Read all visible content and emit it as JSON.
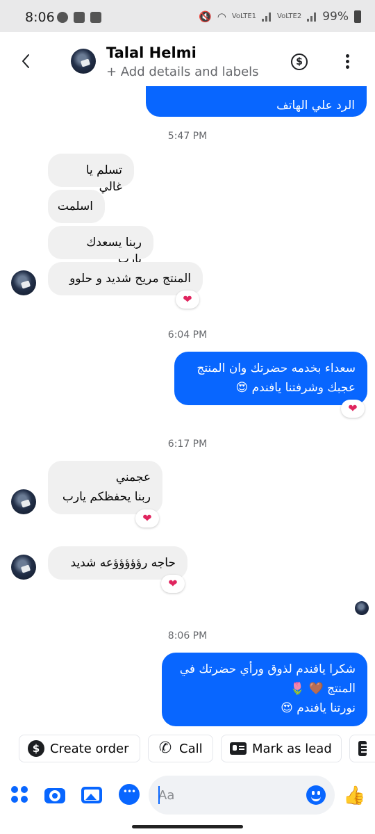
{
  "status_bar": {
    "time": "8:06",
    "lte1": "VoLTE1",
    "lte2": "VoLTE2",
    "battery": "99%"
  },
  "header": {
    "name": "Talal Helmi",
    "subtitle": "+ Add details and labels"
  },
  "messages": {
    "out_top": "الرد علي الهاتف",
    "stamp1": "5:47 PM",
    "in1": "تسلم يا غالي",
    "in2": "اسلمت",
    "in3": "ربنا يسعدك يارب",
    "in4": "المنتج مريح شديد و حلوو",
    "stamp2": "6:04 PM",
    "out1_line1": "سعداء بخدمه حضرتك وان المنتج",
    "out1_line2": "عجبك وشرفتنا يافندم 😍",
    "stamp3": "6:17 PM",
    "in5_line1": "عجمني",
    "in5_line2": "ربنا يحفظكم يارب",
    "in6": "حاجه رؤؤؤؤؤعه شديد",
    "stamp4": "8:06 PM",
    "out2_line1": "شكرا يافندم لذوق ورأي حضرتك في",
    "out2_line2": "المنتج 🤎 🌷",
    "out2_line3": "نورتنا يافندم 😍",
    "reaction": "❤"
  },
  "quick_actions": {
    "create_order": "Create order",
    "call": "Call",
    "mark_as_lead": "Mark as lead"
  },
  "composer": {
    "placeholder": "Aa"
  }
}
